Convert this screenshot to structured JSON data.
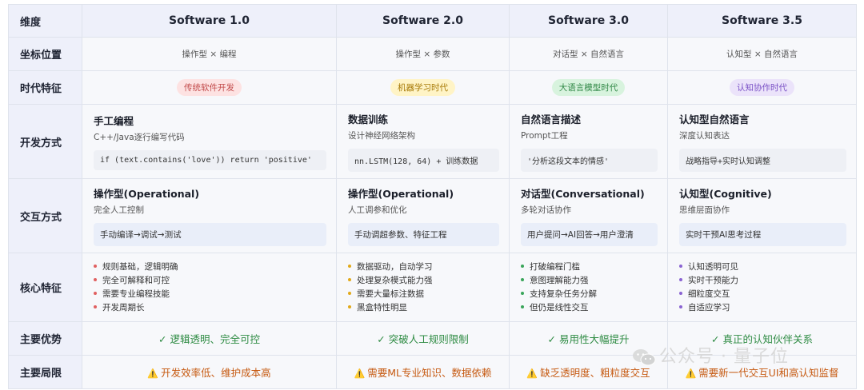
{
  "columns": [
    "维度",
    "Software 1.0",
    "Software 2.0",
    "Software 3.0",
    "Software 3.5"
  ],
  "rows": {
    "coord": {
      "label": "坐标位置",
      "values": [
        "操作型 × 编程",
        "操作型 × 参数",
        "对话型 × 自然语言",
        "认知型 × 自然语言"
      ]
    },
    "era": {
      "label": "时代特征",
      "values": [
        "传统软件开发",
        "机器学习时代",
        "大语言模型时代",
        "认知协作时代"
      ],
      "colors": [
        {
          "bg": "#fde2e2",
          "fg": "#c24a4a"
        },
        {
          "bg": "#fff4c6",
          "fg": "#a77a07"
        },
        {
          "bg": "#d8f3de",
          "fg": "#2f8745"
        },
        {
          "bg": "#ebe3fa",
          "fg": "#7a51c6"
        }
      ]
    },
    "dev": {
      "label": "开发方式",
      "cells": [
        {
          "title": "手工编程",
          "sub": "C++/Java逐行编写代码",
          "code": "if (text.contains('love')) return 'positive'"
        },
        {
          "title": "数据训练",
          "sub": "设计神经网络架构",
          "code": "nn.LSTM(128, 64) + 训练数据"
        },
        {
          "title": "自然语言描述",
          "sub": "Prompt工程",
          "code": "'分析这段文本的情感'"
        },
        {
          "title": "认知型自然语言",
          "sub": "深度认知表达",
          "code": "战略指导+实时认知调整"
        }
      ]
    },
    "interact": {
      "label": "交互方式",
      "cells": [
        {
          "title": "操作型(Operational)",
          "sub": "完全人工控制",
          "box": "手动编译→调试→测试"
        },
        {
          "title": "操作型(Operational)",
          "sub": "人工调参和优化",
          "box": "手动调超参数、特征工程"
        },
        {
          "title": "对话型(Conversational)",
          "sub": "多轮对话协作",
          "box": "用户提问→AI回答→用户澄清"
        },
        {
          "title": "认知型(Cognitive)",
          "sub": "思维层面协作",
          "box": "实时干预AI思考过程"
        }
      ]
    },
    "core": {
      "label": "核心特征",
      "bullet_colors": [
        "#e06060",
        "#e2a91a",
        "#3aa55a",
        "#8a63d2"
      ],
      "cells": [
        [
          "规则基础，逻辑明确",
          "完全可解释和可控",
          "需要专业编程技能",
          "开发周期长"
        ],
        [
          "数据驱动，自动学习",
          "处理复杂模式能力强",
          "需要大量标注数据",
          "黑盒特性明显"
        ],
        [
          "打破编程门槛",
          "意图理解能力强",
          "支持复杂任务分解",
          "但仍是线性交互"
        ],
        [
          "认知透明可见",
          "实时干预能力",
          "细粒度交互",
          "自适应学习"
        ]
      ]
    },
    "adv": {
      "label": "主要优势",
      "values": [
        "✓ 逻辑透明、完全可控",
        "✓ 突破人工规则限制",
        "✓ 易用性大幅提升",
        "✓ 真正的认知伙伴关系"
      ]
    },
    "lim": {
      "label": "主要局限",
      "icon": "warning-icon",
      "values": [
        "开发效率低、维护成本高",
        "需要ML专业知识、数据依赖",
        "缺乏透明度、粗粒度交互",
        "需要新一代交互UI和高认知监督"
      ]
    }
  },
  "watermark": {
    "icon": "wechat-icon",
    "text": "公众号 · 量子位"
  }
}
